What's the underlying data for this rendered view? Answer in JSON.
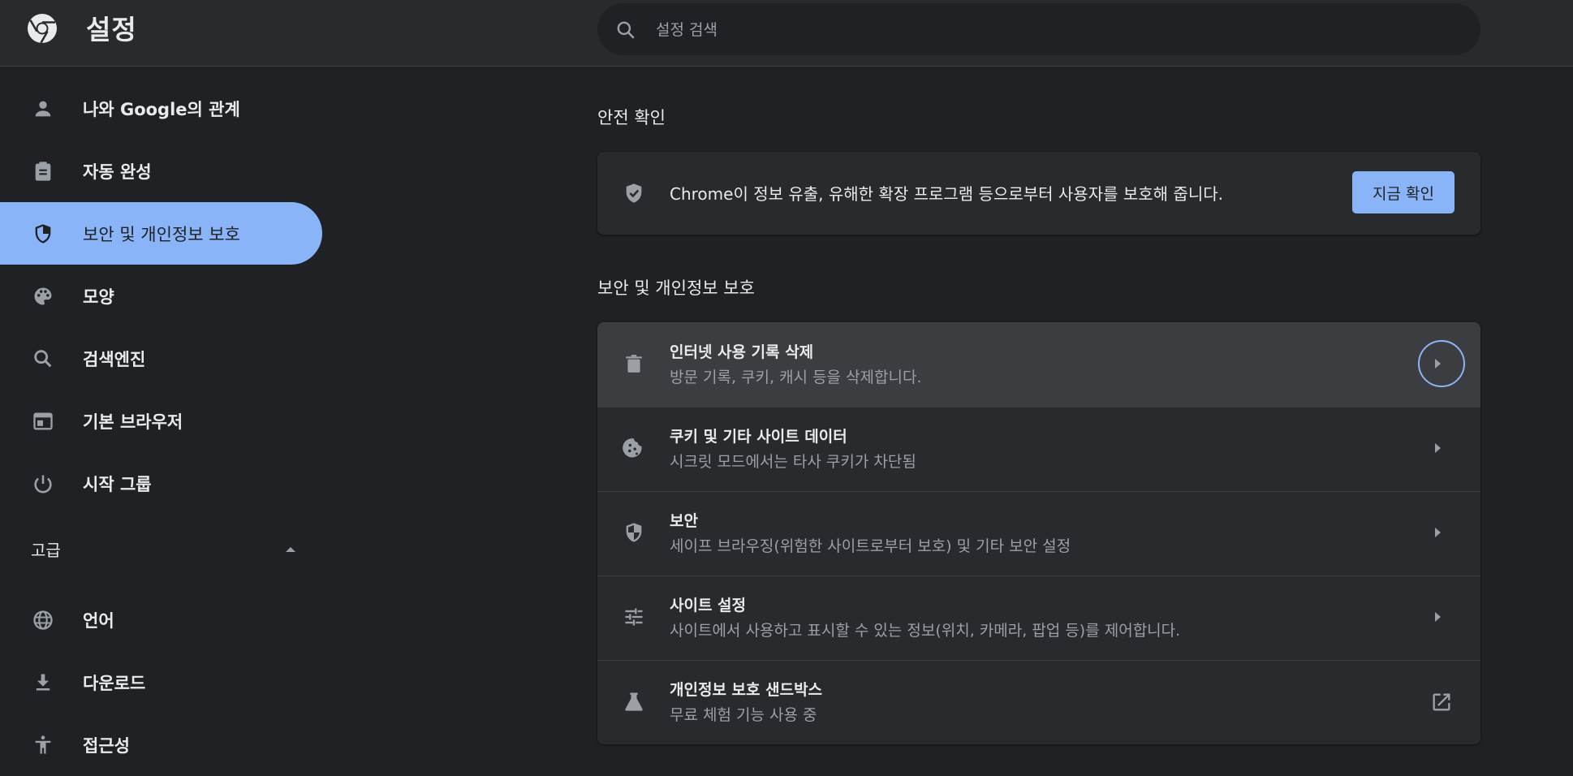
{
  "header": {
    "title": "설정",
    "search_placeholder": "설정 검색"
  },
  "sidebar": {
    "items": [
      {
        "label": "나와 Google의 관계",
        "icon": "person-icon"
      },
      {
        "label": "자동 완성",
        "icon": "clipboard-icon"
      },
      {
        "label": "보안 및 개인정보 보호",
        "icon": "shield-icon",
        "active": true
      },
      {
        "label": "모양",
        "icon": "palette-icon"
      },
      {
        "label": "검색엔진",
        "icon": "search-icon"
      },
      {
        "label": "기본 브라우저",
        "icon": "browser-window-icon"
      },
      {
        "label": "시작 그룹",
        "icon": "power-icon"
      }
    ],
    "advanced_label": "고급",
    "advanced_items": [
      {
        "label": "언어",
        "icon": "globe-icon"
      },
      {
        "label": "다운로드",
        "icon": "download-icon"
      },
      {
        "label": "접근성",
        "icon": "accessibility-icon"
      }
    ]
  },
  "safety_check": {
    "section_title": "안전 확인",
    "text": "Chrome이 정보 유출, 유해한 확장 프로그램 등으로부터 사용자를 보호해 줍니다.",
    "button_label": "지금 확인"
  },
  "privacy": {
    "section_title": "보안 및 개인정보 보호",
    "rows": [
      {
        "title": "인터넷 사용 기록 삭제",
        "subtitle": "방문 기록, 쿠키, 캐시 등을 삭제합니다.",
        "icon": "trash-icon"
      },
      {
        "title": "쿠키 및 기타 사이트 데이터",
        "subtitle": "시크릿 모드에서는 타사 쿠키가 차단됨",
        "icon": "cookie-icon"
      },
      {
        "title": "보안",
        "subtitle": "세이프 브라우징(위험한 사이트로부터 보호) 및 기타 보안 설정",
        "icon": "shield-icon"
      },
      {
        "title": "사이트 설정",
        "subtitle": "사이트에서 사용하고 표시할 수 있는 정보(위치, 카메라, 팝업 등)를 제어합니다.",
        "icon": "tune-icon"
      },
      {
        "title": "개인정보 보호 샌드박스",
        "subtitle": "무료 체험 기능 사용 중",
        "icon": "flask-icon"
      }
    ]
  },
  "colors": {
    "accent": "#8ab4f8",
    "background": "#202124",
    "card": "#292a2d"
  }
}
